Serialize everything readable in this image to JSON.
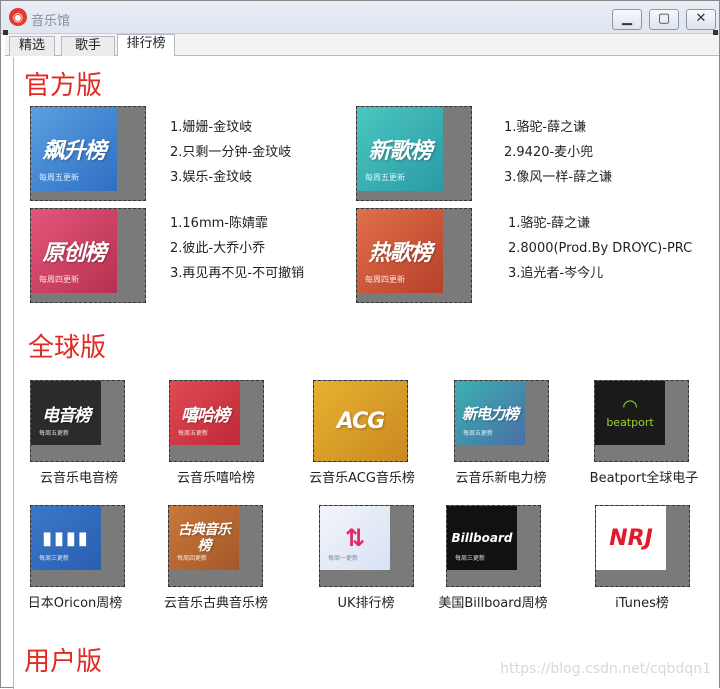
{
  "app": {
    "title": "音乐馆",
    "icon": "netease-cloud-music-icon"
  },
  "window_controls": {
    "minimize": "▭",
    "maximize": "▢",
    "close": "✕"
  },
  "tabs": [
    {
      "label": "精选"
    },
    {
      "label": "歌手"
    },
    {
      "label": "排行榜"
    }
  ],
  "sections": {
    "official": {
      "title": "官方版",
      "charts": [
        {
          "cover_text": "飙升榜",
          "cover_sub": "每周五更新",
          "songs": [
            "1.姗姗-金玟岐",
            "2.只剩一分钟-金玟岐",
            "3.娱乐-金玟岐"
          ]
        },
        {
          "cover_text": "新歌榜",
          "cover_sub": "每周五更新",
          "songs": [
            "1.骆驼-薛之谦",
            "2.9420-麦小兜",
            "3.像风一样-薛之谦"
          ]
        },
        {
          "cover_text": "原创榜",
          "cover_sub": "每周四更新",
          "songs": [
            "1.16mm-陈婧霏",
            "2.彼此-大乔小乔",
            "3.再见再不见-不可撤销"
          ]
        },
        {
          "cover_text": "热歌榜",
          "cover_sub": "每周四更新",
          "songs": [
            "1.骆驼-薛之谦",
            "2.8000(Prod.By DROYC)-PRC",
            "3.追光者-岑今儿"
          ]
        }
      ]
    },
    "global": {
      "title": "全球版",
      "charts": [
        {
          "cover_text": "电音榜",
          "cover_sub": "每周五更新",
          "caption": "云音乐电音榜"
        },
        {
          "cover_text": "嘻哈榜",
          "cover_sub": "每周五更新",
          "caption": "云音乐嘻哈榜"
        },
        {
          "cover_text": "ACG",
          "cover_sub": "",
          "caption": "云音乐ACG音乐榜"
        },
        {
          "cover_text": "新电力榜",
          "cover_sub": "每周五更新",
          "caption": "云音乐新电力榜"
        },
        {
          "cover_text": "beatport",
          "cover_sub": "",
          "caption": "Beatport全球电子"
        },
        {
          "cover_text": "",
          "cover_sub": "每周三更新",
          "caption": "日本Oricon周榜"
        },
        {
          "cover_text": "古典音乐榜",
          "cover_sub": "每周四更新",
          "caption": "云音乐古典音乐榜"
        },
        {
          "cover_text": "",
          "cover_sub": "每周一更新",
          "caption": "UK排行榜"
        },
        {
          "cover_text": "Billboard",
          "cover_sub": "每周三更新",
          "caption": "美国Billboard周榜"
        },
        {
          "cover_text": "NRJ",
          "cover_sub": "",
          "caption": "iTunes榜"
        }
      ]
    },
    "user": {
      "title": "用户版"
    }
  },
  "watermark": "https://blog.csdn.net/cqbdqn1",
  "colors": {
    "accent": "#e02a22"
  }
}
